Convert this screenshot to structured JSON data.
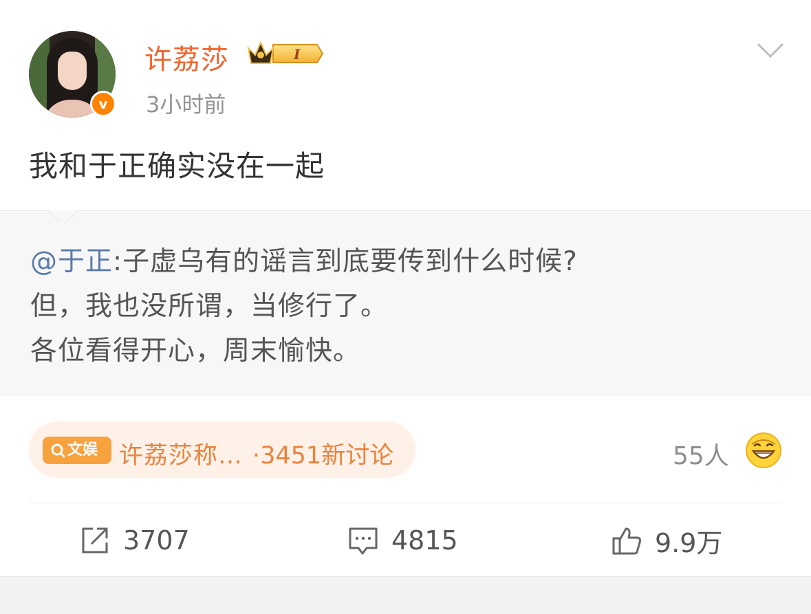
{
  "author": {
    "name": "许荔莎",
    "verified_badge": "v",
    "vip_level": "I",
    "time": "3小时前"
  },
  "post": {
    "text": "我和于正确实没在一起"
  },
  "repost": {
    "mention": "@于正",
    "line1_rest": ":子虚乌有的谣言到底要传到什么时候?",
    "line2": "但，我也没所谓，当修行了。",
    "line3": "各位看得开心，周末愉快。"
  },
  "topic": {
    "tag": "文娱",
    "title": "许荔莎称…",
    "count": "·3451新讨论"
  },
  "reactions": {
    "people": "55人",
    "emoji": "grinning-sweat-icon"
  },
  "actions": {
    "share": "3707",
    "comment": "4815",
    "like": "9.9万"
  },
  "colors": {
    "username": "#f1642e",
    "badge": "#ff8200",
    "mention": "#5b7ba8",
    "topic_text": "#e9833d",
    "topic_bg": "#fff1e7"
  }
}
